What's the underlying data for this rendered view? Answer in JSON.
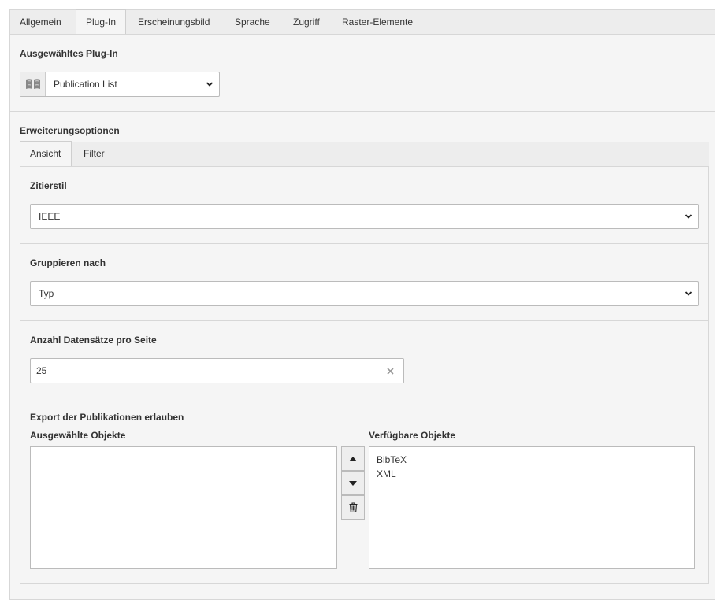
{
  "tabs": [
    "Allgemein",
    "Plug-In",
    "Erscheinungsbild",
    "Sprache",
    "Zugriff",
    "Raster-Elemente"
  ],
  "active_tab": "Plug-In",
  "plugin_section": {
    "label": "Ausgewähltes Plug-In",
    "selected": "Publication List",
    "icon": "book-icon"
  },
  "extension": {
    "label": "Erweiterungsoptionen",
    "tabs": [
      "Ansicht",
      "Filter"
    ],
    "active_tab": "Ansicht"
  },
  "citation": {
    "label": "Zitierstil",
    "value": "IEEE"
  },
  "grouping": {
    "label": "Gruppieren nach",
    "value": "Typ"
  },
  "records": {
    "label": "Anzahl Datensätze pro Seite",
    "value": "25",
    "clear_icon": "close-icon"
  },
  "export": {
    "label": "Export der Publikationen erlauben",
    "selected_label": "Ausgewählte Objekte",
    "available_label": "Verfügbare Objekte",
    "selected_items": [],
    "available_items": [
      "BibTeX",
      "XML"
    ]
  },
  "colors": {
    "panel_bg": "#f5f5f5",
    "tab_bg": "#ededed",
    "border": "#d7d7d7"
  }
}
